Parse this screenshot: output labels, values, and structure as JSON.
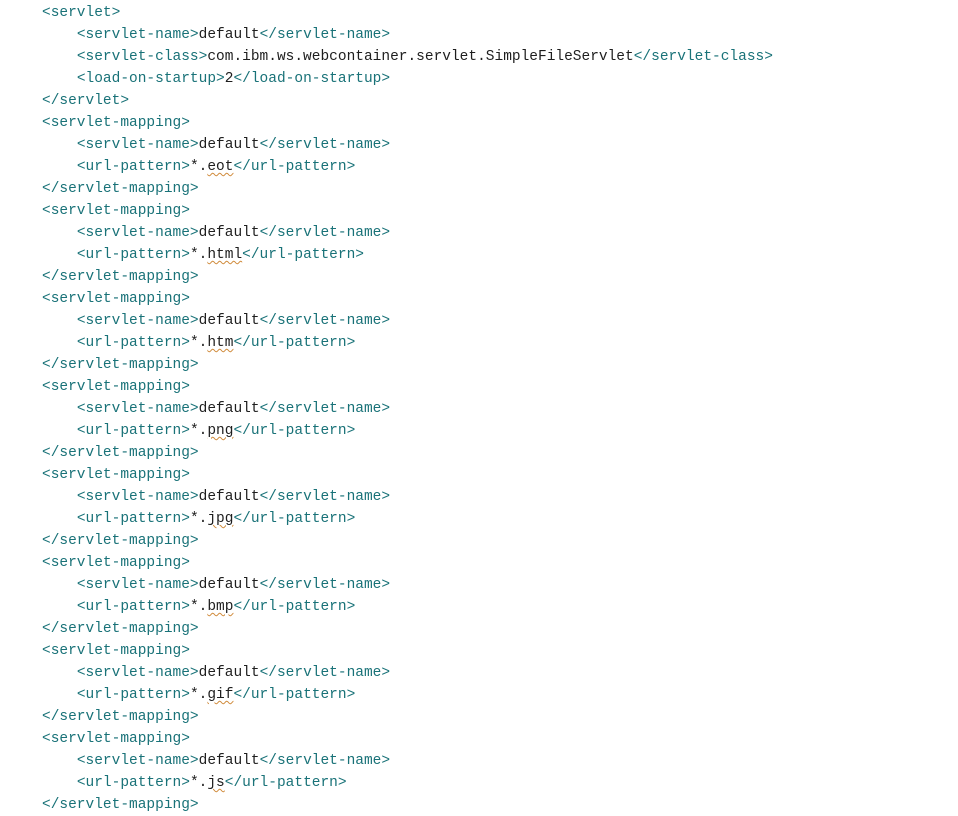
{
  "indent1": "    ",
  "indent2": "        ",
  "tags": {
    "servlet_o": "<servlet>",
    "servlet_c": "</servlet>",
    "servlet_name_o": "<servlet-name>",
    "servlet_name_c": "</servlet-name>",
    "servlet_class_o": "<servlet-class>",
    "servlet_class_c": "</servlet-class>",
    "load_startup_o": "<load-on-startup>",
    "load_startup_c": "</load-on-startup>",
    "servlet_mapping_o": "<servlet-mapping>",
    "servlet_mapping_c": "</servlet-mapping>",
    "url_pattern_o": "<url-pattern>",
    "url_pattern_c": "</url-pattern>"
  },
  "vals": {
    "default": "default",
    "servlet_class": "com.ibm.ws.webcontainer.servlet.SimpleFileServlet",
    "startup": "2",
    "star_dot": "*.",
    "eot": "eot",
    "html": "html",
    "htm": "htm",
    "png": "png",
    "jpg": "jpg",
    "bmp": "bmp",
    "gif": "gif",
    "js": "js"
  }
}
